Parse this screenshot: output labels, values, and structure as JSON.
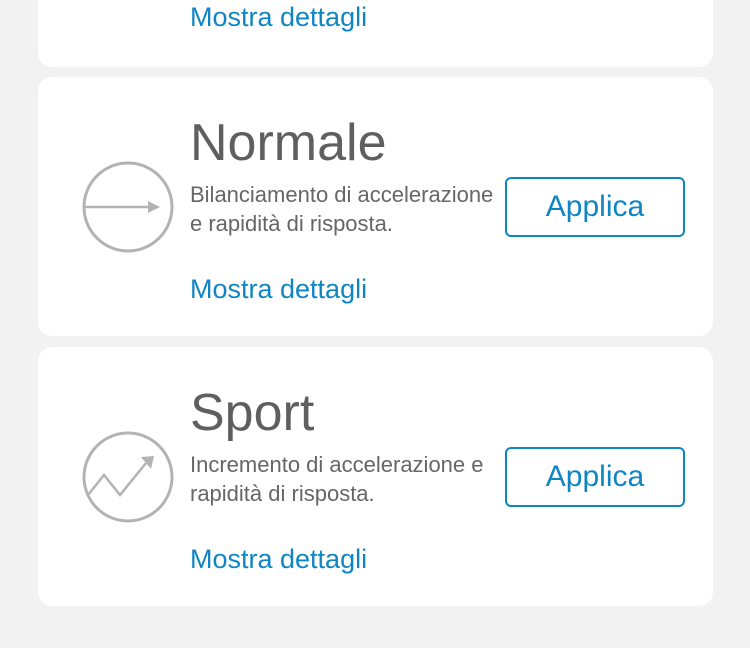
{
  "modes": {
    "previous": {
      "details_label": "Mostra dettagli"
    },
    "normal": {
      "title": "Normale",
      "description": "Bilanciamento di accelerazione e rapidità di risposta.",
      "details_label": "Mostra dettagli",
      "apply_label": "Applica",
      "icon": "arrow-right-circle-icon"
    },
    "sport": {
      "title": "Sport",
      "description": "Incremento di accelerazione e rapidità di risposta.",
      "details_label": "Mostra dettagli",
      "apply_label": "Applica",
      "icon": "zigzag-up-circle-icon"
    }
  },
  "colors": {
    "accent": "#0f85c4",
    "title_text": "#5f5f5f",
    "body_text": "#666666",
    "icon_stroke": "#b3b3b3",
    "card_background": "#ffffff",
    "page_background": "#f2f2f2"
  }
}
